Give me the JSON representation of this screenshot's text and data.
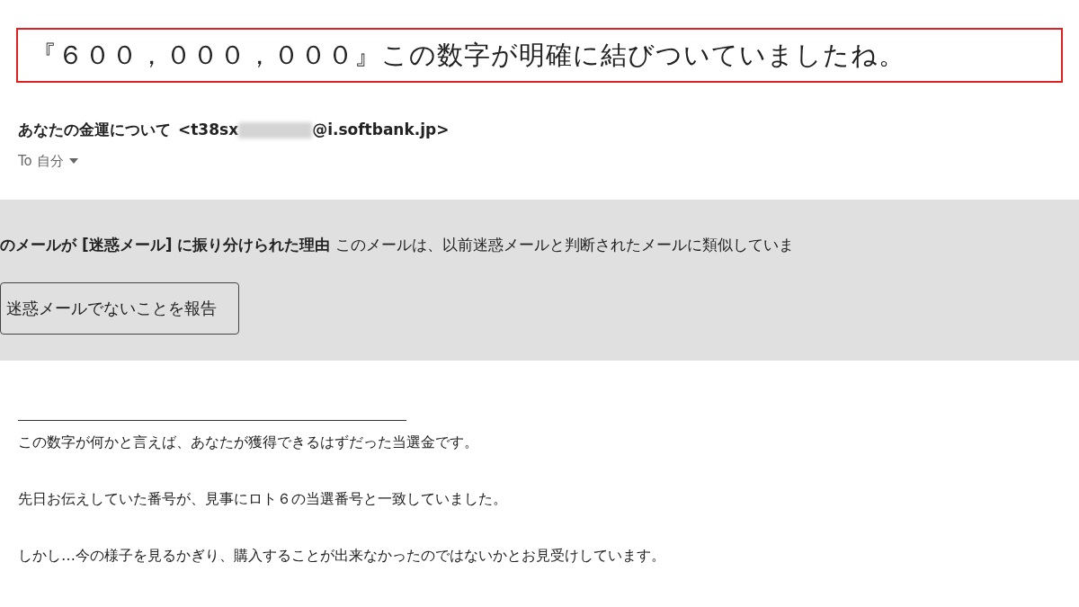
{
  "subject": "『６００，０００，０００』この数字が明確に結びついていましたね。",
  "sender": {
    "name": "あなたの金運について",
    "address_start": "<t38sx",
    "address_end": "@i.softbank.jp>",
    "redacted": true
  },
  "recipient": {
    "label": "To 自分"
  },
  "spam_banner": {
    "text": "**のメールが [迷惑メール] に振り分けられた理由** このメールは、以前迷惑メールと判断されたメールに類似していま",
    "button": "迷惑メールでないことを報告"
  },
  "body": [
    "この数字が何かと言えば、あなたが獲得できるはずだった当選金です。",
    "先日お伝えしていた番号が、見事にロト６の当選番号と一致していました。",
    "しかし…今の様子を見るかぎり、購入することが出来なかったのではないかとお見受けしています。"
  ]
}
